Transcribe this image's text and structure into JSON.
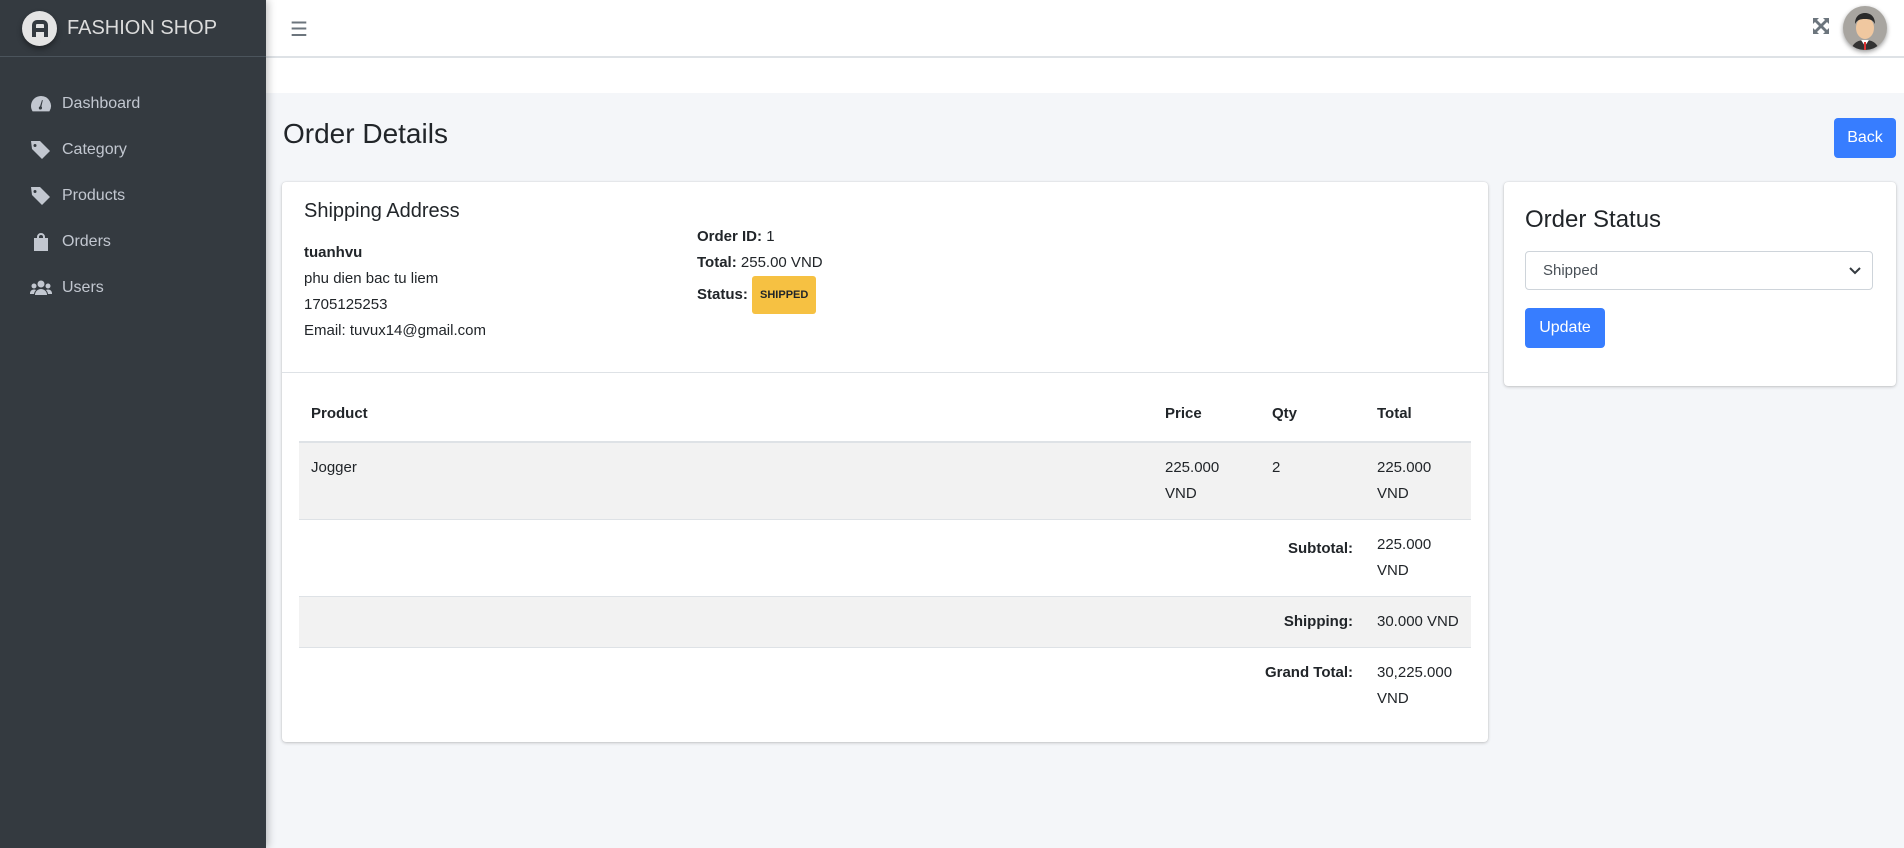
{
  "brand": {
    "name": "FASHION SHOP"
  },
  "sidebar": {
    "items": [
      {
        "label": "Dashboard",
        "icon": "dashboard-icon"
      },
      {
        "label": "Category",
        "icon": "tag-icon"
      },
      {
        "label": "Products",
        "icon": "tag-icon"
      },
      {
        "label": "Orders",
        "icon": "shopping-bag-icon"
      },
      {
        "label": "Users",
        "icon": "users-icon"
      }
    ]
  },
  "header": {
    "menu_icon": "hamburger-icon",
    "fullscreen_icon": "expand-icon"
  },
  "page": {
    "title": "Order Details",
    "back_label": "Back"
  },
  "shipping": {
    "title": "Shipping Address",
    "name": "tuanhvu",
    "address": "phu dien bac tu liem",
    "phone": "1705125253",
    "email": "Email: tuvux14@gmail.com"
  },
  "order": {
    "id_label": "Order ID:",
    "id": "1",
    "total_label": "Total:",
    "total": "255.00 VND",
    "status_label": "Status:",
    "status": "SHIPPED",
    "status_color": "#f6c142"
  },
  "table": {
    "headers": [
      "Product",
      "Price",
      "Qty",
      "Total"
    ],
    "rows": [
      {
        "product": "Jogger",
        "price": "225.000 VND",
        "qty": "2",
        "total": "225.000 VND"
      }
    ],
    "subtotal_label": "Subtotal:",
    "subtotal": "225.000 VND",
    "shipping_label": "Shipping:",
    "shipping": "30.000 VND",
    "grand_label": "Grand Total:",
    "grand": "30,225.000 VND"
  },
  "status_panel": {
    "title": "Order Status",
    "selected": "Shipped",
    "update_label": "Update"
  },
  "colors": {
    "primary": "#377dff",
    "sidebar": "#343a40"
  }
}
